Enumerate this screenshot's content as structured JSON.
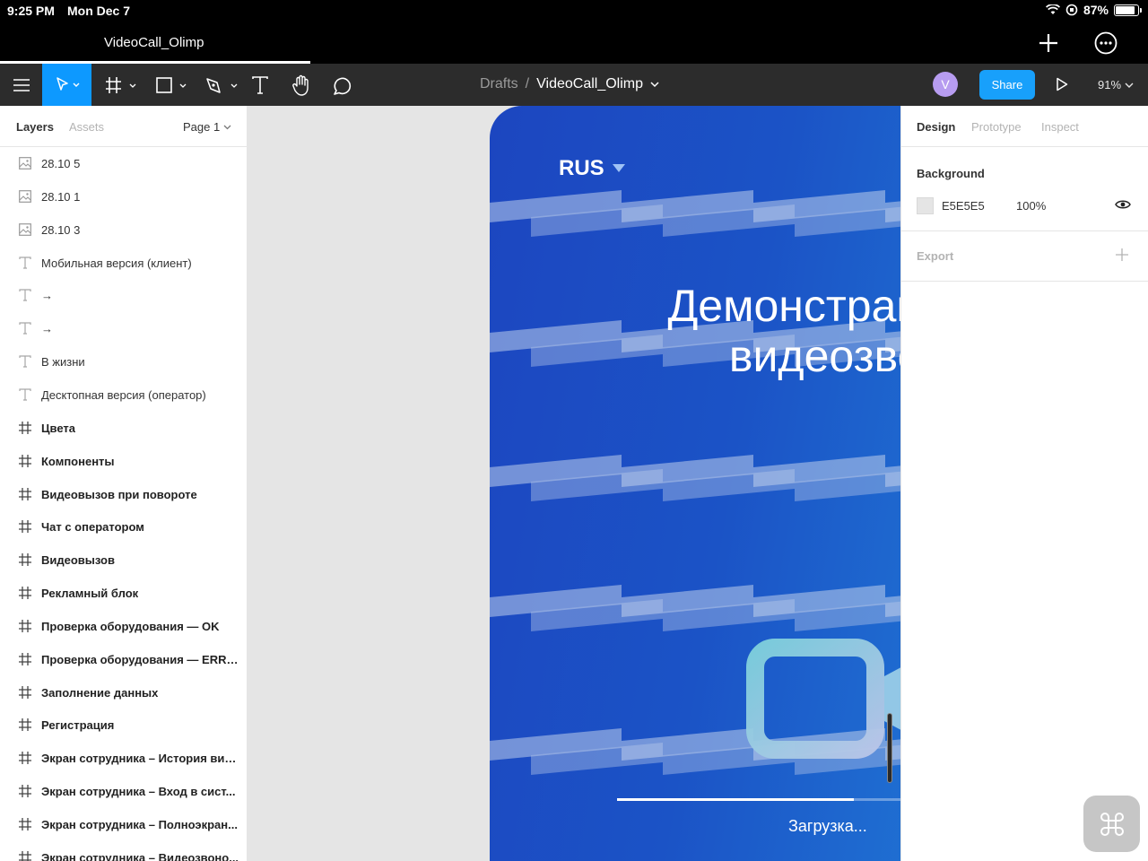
{
  "status_bar": {
    "time": "9:25 PM",
    "date": "Mon Dec 7",
    "battery": "87%",
    "battery_level": 0.87
  },
  "tab": {
    "title": "VideoCall_Olimp"
  },
  "toolbar": {
    "breadcrumb_root": "Drafts",
    "breadcrumb_sep": "/",
    "file_name": "VideoCall_Olimp",
    "avatar_initial": "V",
    "share_label": "Share",
    "zoom": "91%"
  },
  "left_panel": {
    "tabs": {
      "layers": "Layers",
      "assets": "Assets"
    },
    "page": "Page 1",
    "layers": [
      {
        "type": "image",
        "name": "28.10 5"
      },
      {
        "type": "image",
        "name": "28.10 1"
      },
      {
        "type": "image",
        "name": "28.10 3"
      },
      {
        "type": "text",
        "name": "Мобильная версия (клиент)"
      },
      {
        "type": "text",
        "name": "→"
      },
      {
        "type": "text",
        "name": "→"
      },
      {
        "type": "text",
        "name": "В жизни"
      },
      {
        "type": "text",
        "name": "Десктопная версия (оператор)"
      },
      {
        "type": "frame",
        "name": "Цвета"
      },
      {
        "type": "frame",
        "name": "Компоненты"
      },
      {
        "type": "frame",
        "name": "Видеовызов при повороте"
      },
      {
        "type": "frame",
        "name": "Чат с оператором"
      },
      {
        "type": "frame",
        "name": "Видеовызов"
      },
      {
        "type": "frame",
        "name": "Рекламный блок"
      },
      {
        "type": "frame",
        "name": "Проверка оборудования — OK"
      },
      {
        "type": "frame",
        "name": "Проверка оборудования — ERROR"
      },
      {
        "type": "frame",
        "name": "Заполнение данных"
      },
      {
        "type": "frame",
        "name": "Регистрация"
      },
      {
        "type": "frame",
        "name": "Экран сотрудника – История вид..."
      },
      {
        "type": "frame",
        "name": "Экран сотрудника – Вход в сист..."
      },
      {
        "type": "frame",
        "name": "Экран сотрудника – Полноэкран..."
      },
      {
        "type": "frame",
        "name": "Экран сотрудника – Видеозвоно..."
      }
    ]
  },
  "canvas": {
    "language": "RUS",
    "title_line1": "Демонстраци",
    "title_line2": "видеозвон",
    "loading_label": "Загрузка...",
    "loading_progress": 0.8
  },
  "right_panel": {
    "tabs": {
      "design": "Design",
      "prototype": "Prototype",
      "inspect": "Inspect"
    },
    "background_title": "Background",
    "background_color": "E5E5E5",
    "background_opacity": "100%",
    "export_title": "Export"
  },
  "colors": {
    "accent": "#0d99ff",
    "share": "#18a0fb",
    "toolbar": "#2c2c2c",
    "canvas": "#e5e5e5",
    "phone_blue": "#1b53c6"
  }
}
